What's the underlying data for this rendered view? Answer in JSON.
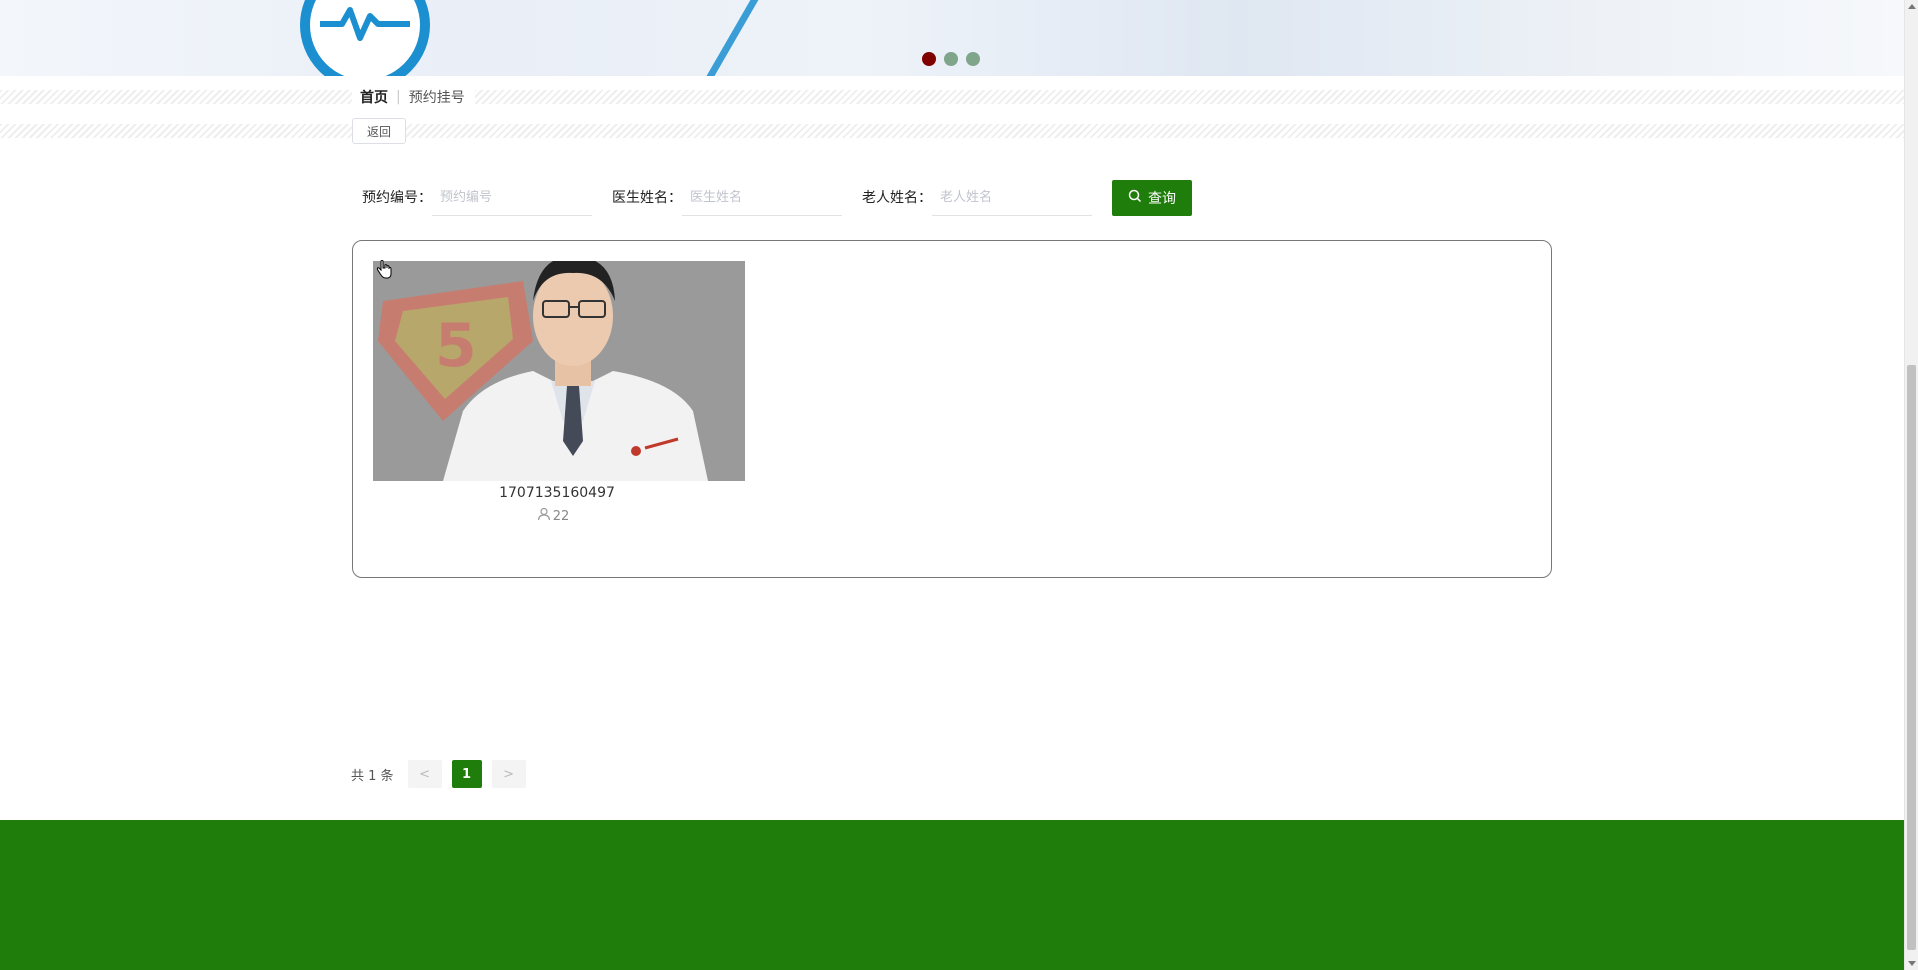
{
  "banner": {
    "dots": [
      {
        "label": "slide-1",
        "active": true
      },
      {
        "label": "slide-2",
        "active": false
      },
      {
        "label": "slide-3",
        "active": false
      }
    ]
  },
  "breadcrumb": {
    "home": "首页",
    "separator": "|",
    "current": "预约挂号"
  },
  "back_button": "返回",
  "search": {
    "appointment_no_label": "预约编号：",
    "appointment_no_placeholder": "预约编号",
    "appointment_no_value": "",
    "doctor_name_label": "医生姓名：",
    "doctor_name_placeholder": "医生姓名",
    "doctor_name_value": "",
    "elder_name_label": "老人姓名：",
    "elder_name_placeholder": "老人姓名",
    "elder_name_value": "",
    "button_label": "查询",
    "button_icon": "search-icon"
  },
  "results": [
    {
      "title": "1707135160497",
      "views": "22",
      "views_icon": "user-icon"
    }
  ],
  "pagination": {
    "total_text": "共 1 条",
    "prev": "<",
    "current_page": "1",
    "next": ">"
  },
  "colors": {
    "primary_green": "#1f7d0b",
    "active_dot": "#800000",
    "inactive_dot": "#7fa58a"
  }
}
